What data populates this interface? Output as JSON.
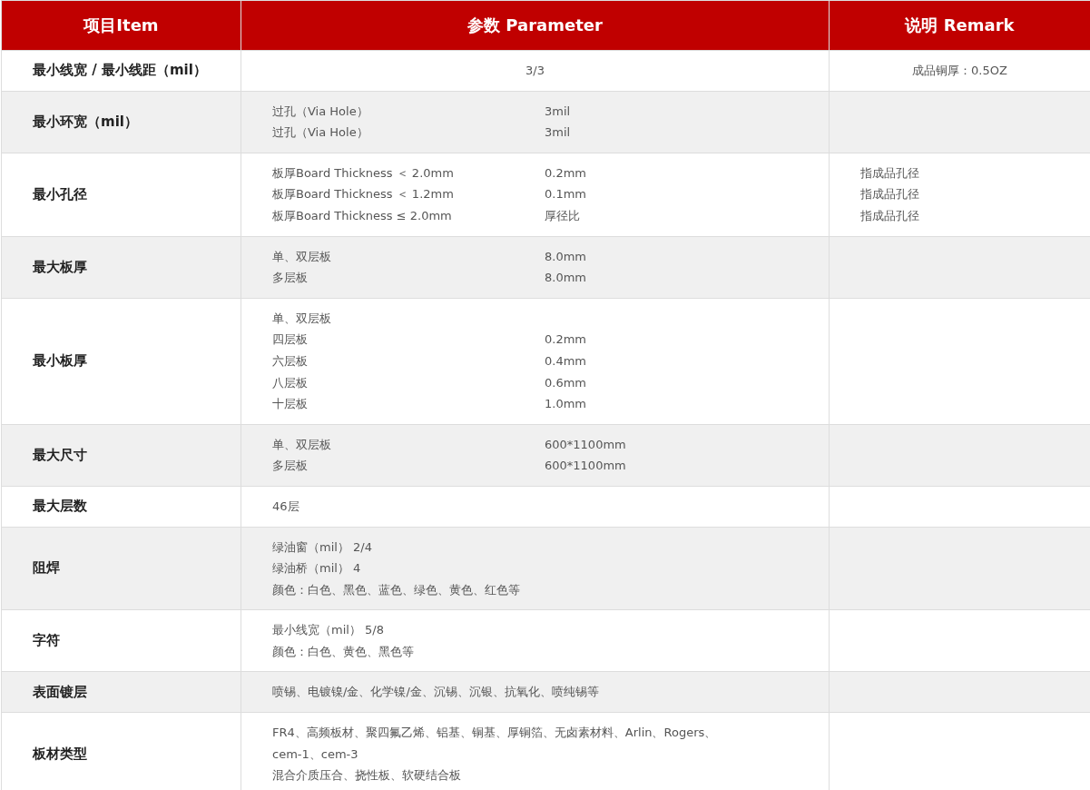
{
  "table": {
    "columns": [
      "项目Item",
      "参数 Parameter",
      "说明 Remark"
    ],
    "rows": [
      {
        "item": "最小线宽 / 最小线距（mil）",
        "centered": true,
        "params": [
          {
            "label": "3/3"
          }
        ],
        "remarks": [
          "成品铜厚：0.5OZ"
        ]
      },
      {
        "item": "最小环宽（mil）",
        "centered": false,
        "params": [
          {
            "label": "过孔（Via Hole）",
            "value": "3mil"
          },
          {
            "label": "过孔（Via Hole）",
            "value": "3mil"
          }
        ],
        "remarks": []
      },
      {
        "item": "最小孔径",
        "centered": false,
        "params": [
          {
            "label": "板厚Board Thickness ＜ 2.0mm",
            "value": "0.2mm"
          },
          {
            "label": "板厚Board Thickness ＜ 1.2mm",
            "value": "0.1mm"
          },
          {
            "label": "板厚Board Thickness ≤ 2.0mm",
            "value": "厚径比"
          }
        ],
        "remarks": [
          "指成品孔径",
          "指成品孔径",
          "指成品孔径"
        ]
      },
      {
        "item": "最大板厚",
        "centered": false,
        "params": [
          {
            "label": "单、双层板",
            "value": "8.0mm"
          },
          {
            "label": "多层板",
            "value": "8.0mm"
          }
        ],
        "remarks": []
      },
      {
        "item": "最小板厚",
        "centered": false,
        "params": [
          {
            "label": "单、双层板"
          },
          {
            "label": "四层板",
            "value": "0.2mm"
          },
          {
            "label": "六层板",
            "value": "0.4mm"
          },
          {
            "label": "八层板",
            "value": "0.6mm"
          },
          {
            "label": "十层板",
            "value": "1.0mm"
          }
        ],
        "remarks": []
      },
      {
        "item": "最大尺寸",
        "centered": false,
        "params": [
          {
            "label": "单、双层板",
            "value": "600*1100mm"
          },
          {
            "label": "多层板",
            "value": "600*1100mm"
          }
        ],
        "remarks": []
      },
      {
        "item": "最大层数",
        "centered": false,
        "params": [
          {
            "label": "46层"
          }
        ],
        "remarks": []
      },
      {
        "item": "阻焊",
        "centered": false,
        "params": [
          {
            "label": "绿油窗（mil） 2/4"
          },
          {
            "label": "绿油桥（mil） 4"
          },
          {
            "label": "颜色：白色、黑色、蓝色、绿色、黄色、红色等"
          }
        ],
        "remarks": []
      },
      {
        "item": "字符",
        "centered": false,
        "params": [
          {
            "label": "最小线宽（mil） 5/8"
          },
          {
            "label": "颜色：白色、黄色、黑色等"
          }
        ],
        "remarks": []
      },
      {
        "item": "表面镀层",
        "centered": false,
        "params": [
          {
            "label": "喷锡、电镀镍/金、化学镍/金、沉锡、沉银、抗氧化、喷纯锡等"
          }
        ],
        "remarks": []
      },
      {
        "item": "板材类型",
        "centered": false,
        "params": [
          {
            "label": "FR4、高频板材、聚四氟乙烯、铝基、铜基、厚铜箔、无卤素材料、Arlin、Rogers、cem-1、cem-3"
          },
          {
            "label": "混合介质压合、挠性板、软硬结合板"
          }
        ],
        "remarks": []
      }
    ]
  }
}
